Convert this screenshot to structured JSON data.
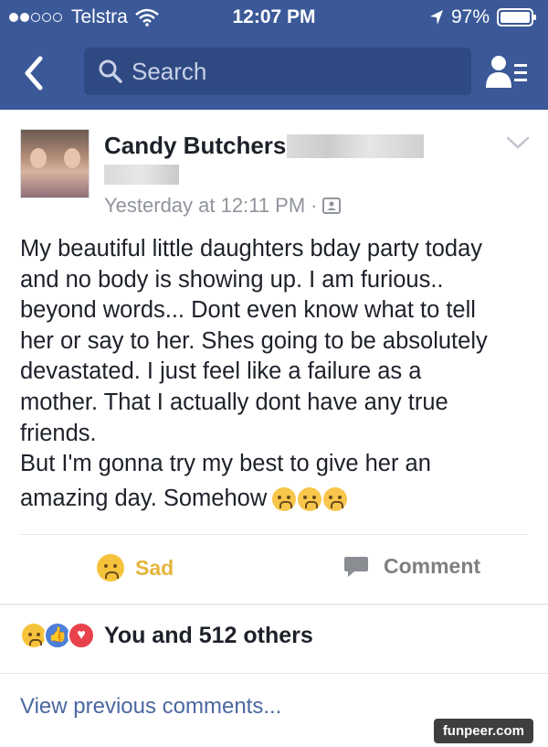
{
  "status_bar": {
    "carrier": "Telstra",
    "time": "12:07 PM",
    "battery": "97%"
  },
  "nav": {
    "search_placeholder": "Search"
  },
  "post": {
    "author": "Candy Butchers",
    "timestamp": "Yesterday at 12:11 PM",
    "separator": "·",
    "body_lines": [
      "My beautiful little daughters bday party today",
      "and no body is showing up. I am furious..",
      "beyond words... Dont even know what to tell",
      "her or say to her. Shes going to be absolutely",
      "devastated. I just feel like a failure as a",
      "mother. That I actually dont have any true",
      "friends.",
      "But I'm gonna try my best to give her an",
      "amazing day. Somehow"
    ],
    "actions": {
      "sad_label": "Sad",
      "comment_label": "Comment"
    },
    "reactions_summary": "You and 512 others",
    "view_previous": "View previous comments..."
  },
  "watermark": "funpeer.com",
  "colors": {
    "header_blue": "#3b5998",
    "search_bg": "#2f4a83",
    "sad_yellow": "#e3b53c",
    "link_blue": "#4b67a1"
  }
}
